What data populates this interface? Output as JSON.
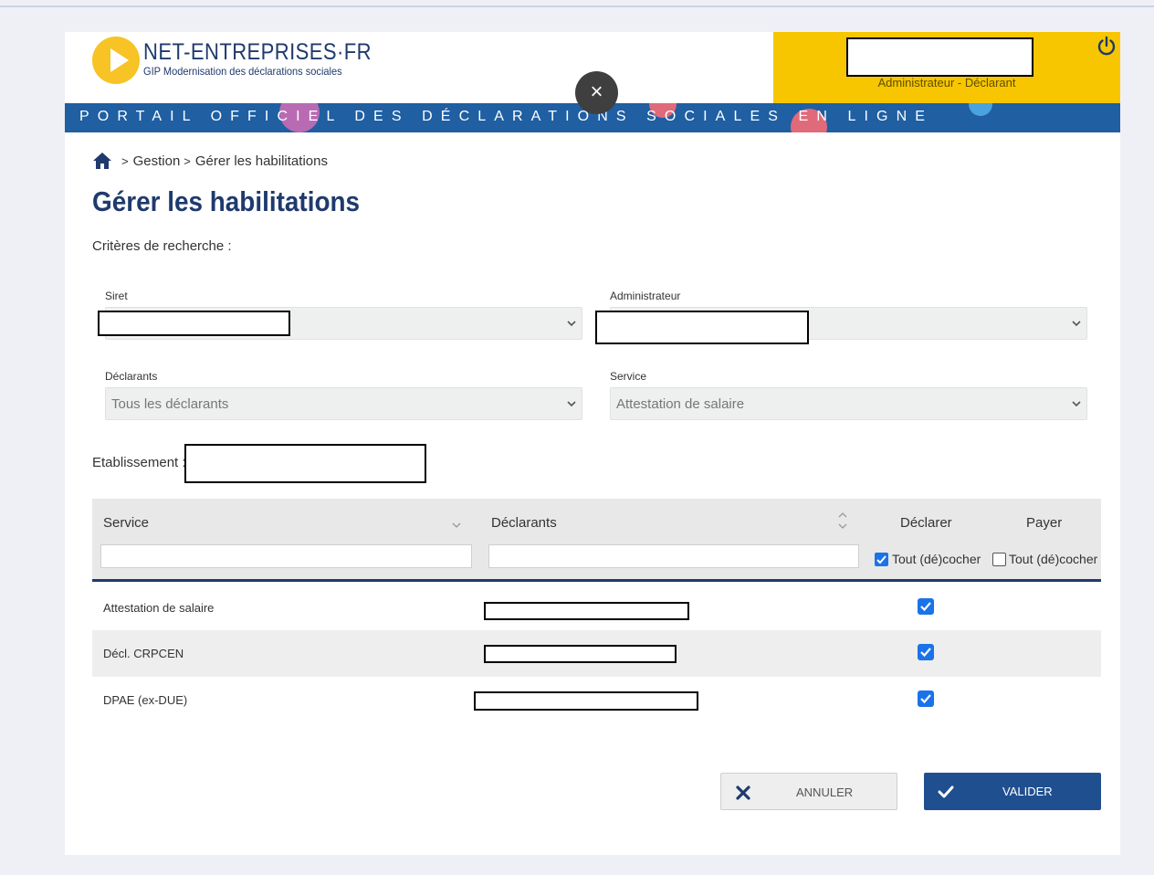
{
  "header": {
    "logo_title": "NET-ENTREPRISES·FR",
    "logo_subtitle": "GIP Modernisation des déclarations sociales",
    "user_role": "Administrateur - Déclarant",
    "banner_text": "PORTAIL OFFICIEL DES DÉCLARATIONS SOCIALES EN LIGNE",
    "close_glyph": "×"
  },
  "breadcrumb": {
    "separator": ">",
    "items": [
      "Gestion",
      "Gérer les habilitations"
    ]
  },
  "page": {
    "title": "Gérer les habilitations",
    "criteria_label": "Critères de recherche :"
  },
  "form": {
    "siret": {
      "label": "Siret",
      "value": ""
    },
    "administrateur": {
      "label": "Administrateur",
      "value": ""
    },
    "declarants": {
      "label": "Déclarants",
      "value": "Tous les déclarants"
    },
    "service": {
      "label": "Service",
      "value": "Attestation de salaire"
    },
    "etablissement_label": "Etablissement :"
  },
  "table": {
    "columns": {
      "service": "Service",
      "declarants": "Déclarants",
      "declarer": "Déclarer",
      "payer": "Payer"
    },
    "toggle_all_label": "Tout (dé)cocher",
    "declarer_all_checked": true,
    "payer_all_checked": false,
    "rows": [
      {
        "service": "Attestation de salaire",
        "declarer": true
      },
      {
        "service": "Décl. CRPCEN",
        "declarer": true
      },
      {
        "service": "DPAE (ex-DUE)",
        "declarer": true
      }
    ]
  },
  "buttons": {
    "cancel": "ANNULER",
    "validate": "VALIDER"
  },
  "icons": {
    "home": "home-icon",
    "power": "power-icon",
    "close": "close-icon",
    "chevron": "chevron-down-icon",
    "sort": "sort-icon",
    "cancel": "x-icon",
    "validate": "check-icon"
  },
  "colors": {
    "brand_blue": "#1f3a6d",
    "banner_blue": "#1f5fa2",
    "header_yellow": "#f7c600",
    "logo_yellow": "#f7c325",
    "checkbox_blue": "#1a73e8",
    "validate_button": "#1f4f8f"
  }
}
